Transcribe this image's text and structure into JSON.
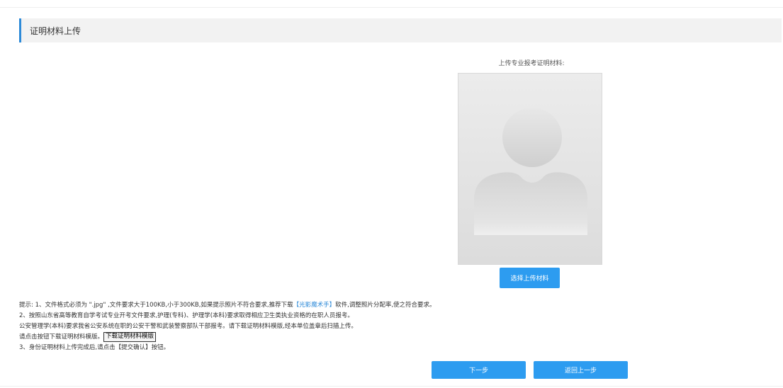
{
  "section": {
    "title": "证明材料上传"
  },
  "upload": {
    "label": "上传专业报考证明材料:",
    "select_button": "选择上传材料",
    "placeholder_icon": "person-silhouette-icon"
  },
  "notes": {
    "line1_prefix": "提示: 1、文件格式必须为 \".jpg\" ,文件要求大于100KB,小于300KB,如果提示照片不符合要求,推荐下载",
    "line1_link": "【光影魔术手】",
    "line1_suffix": "软件,调整照片分配率,使之符合要求。",
    "line2": "2、按照山东省高等教育自学考试专业开考文件要求,护理(专科)、护理学(本科)要求取得相应卫生类执业资格的在职人员报考。",
    "line3": "公安管理学(本科)要求我省公安系统在职的公安干警和武装警察部队干部报考。请下载证明材料模版,经本单位盖章后扫描上传。",
    "line4_prefix": "请点击按钮下载证明材料模版。",
    "download_button": "下载证明材料模版",
    "line5": "3、身份证明材料上传完成后,请点击【提交确认】按钮。"
  },
  "actions": {
    "next": "下一步",
    "back": "返回上一步"
  },
  "colors": {
    "accent": "#2d9cf0",
    "header_border": "#2d8ad8",
    "header_bg": "#f2f2f2",
    "link": "#2d8ad8"
  }
}
